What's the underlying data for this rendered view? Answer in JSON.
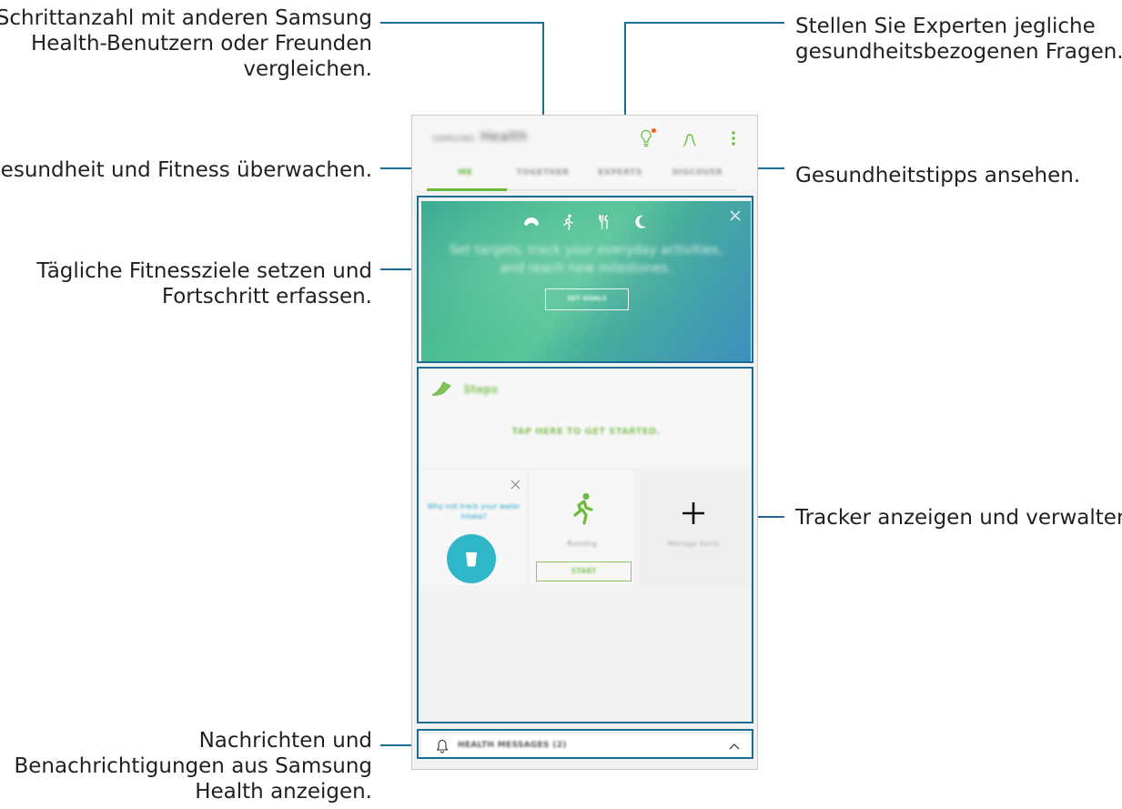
{
  "annotations": {
    "together": [
      "Schrittanzahl mit anderen Samsung",
      "Health-Benutzern oder Freunden",
      "vergleichen."
    ],
    "experts": [
      "Stellen Sie Experten jegliche",
      "gesundheitsbezogenen Fragen."
    ],
    "me": [
      "Gesundheit und Fitness überwachen."
    ],
    "discover": [
      "Gesundheitstipps ansehen."
    ],
    "goals": [
      "Tägliche Fitnessziele setzen und",
      "Fortschritt erfassen."
    ],
    "trackers": [
      "Tracker anzeigen und verwalten."
    ],
    "messages": [
      "Nachrichten und",
      "Benachrichtigungen aus Samsung",
      "Health anzeigen."
    ]
  },
  "app": {
    "brand": "SAMSUNG",
    "title": "Health",
    "tabs": [
      "ME",
      "TOGETHER",
      "EXPERTS",
      "DISCOVER"
    ],
    "active_tab": "ME",
    "accent": "#6cbb3c",
    "notification_dot": "#f05a28"
  },
  "banner": {
    "text": "Set targets, track your everyday activities, and reach new milestones.",
    "button": "SET GOALS",
    "icons": [
      "weight-icon",
      "running-icon",
      "food-icon",
      "sleep-icon"
    ]
  },
  "steps": {
    "title": "Steps",
    "cta": "TAP HERE TO GET STARTED."
  },
  "trackers": {
    "water": {
      "text": "Why not track your water intake?"
    },
    "running": {
      "label": "Running",
      "button": "START"
    },
    "manage": {
      "label": "Manage items"
    }
  },
  "messages": {
    "label": "HEALTH MESSAGES (2)"
  },
  "colors": {
    "annotation_line": "#1a6d96",
    "water": "#2fb6c9",
    "green": "#8cc665"
  }
}
